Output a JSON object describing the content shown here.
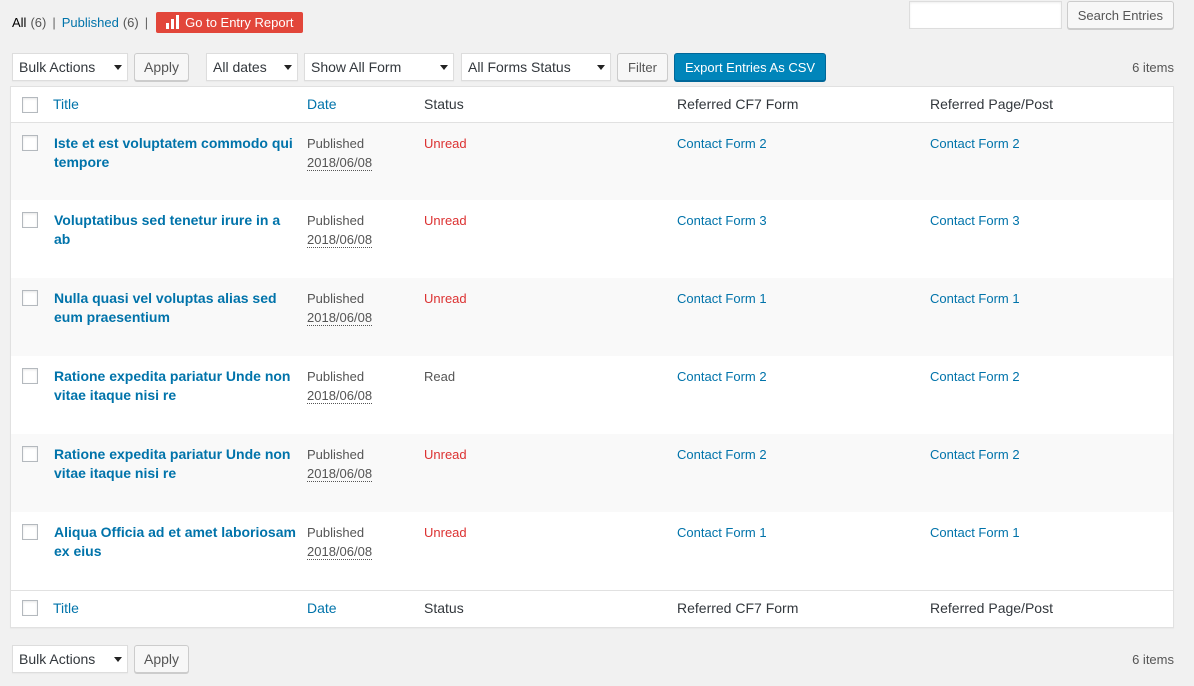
{
  "views": {
    "all_label": "All",
    "all_count": "(6)",
    "published_label": "Published",
    "published_count": "(6)",
    "separator": "|",
    "report_button": "Go to Entry Report"
  },
  "search": {
    "value": "",
    "button_label": "Search Entries"
  },
  "top_nav": {
    "bulk_actions": "Bulk Actions",
    "apply": "Apply",
    "dates_filter": "All dates",
    "form_filter": "Show All Form",
    "status_filter": "All Forms Status",
    "filter_button": "Filter",
    "export_button": "Export Entries As CSV",
    "items_count": "6 items"
  },
  "columns": {
    "title": "Title",
    "date": "Date",
    "status": "Status",
    "form": "Referred CF7 Form",
    "page": "Referred Page/Post"
  },
  "rows": [
    {
      "title": "Iste et est voluptatem commodo qui tempore",
      "date_status": "Published",
      "date": "2018/06/08",
      "status": "Unread",
      "form": "Contact Form 2",
      "page": "Contact Form 2"
    },
    {
      "title": "Voluptatibus sed tenetur irure in a ab",
      "date_status": "Published",
      "date": "2018/06/08",
      "status": "Unread",
      "form": "Contact Form 3",
      "page": "Contact Form 3"
    },
    {
      "title": "Nulla quasi vel voluptas alias sed eum praesentium",
      "date_status": "Published",
      "date": "2018/06/08",
      "status": "Unread",
      "form": "Contact Form 1",
      "page": "Contact Form 1"
    },
    {
      "title": "Ratione expedita pariatur Unde non vitae itaque nisi re",
      "date_status": "Published",
      "date": "2018/06/08",
      "status": "Read",
      "form": "Contact Form 2",
      "page": "Contact Form 2"
    },
    {
      "title": "Ratione expedita pariatur Unde non vitae itaque nisi re",
      "date_status": "Published",
      "date": "2018/06/08",
      "status": "Unread",
      "form": "Contact Form 2",
      "page": "Contact Form 2"
    },
    {
      "title": "Aliqua Officia ad et amet laboriosam ex eius",
      "date_status": "Published",
      "date": "2018/06/08",
      "status": "Unread",
      "form": "Contact Form 1",
      "page": "Contact Form 1"
    }
  ],
  "bottom_nav": {
    "bulk_actions": "Bulk Actions",
    "apply": "Apply",
    "items_count": "6 items"
  },
  "colors": {
    "link": "#0073aa",
    "unread": "#dc3232",
    "primary": "#0085ba",
    "report": "#e2463a"
  }
}
